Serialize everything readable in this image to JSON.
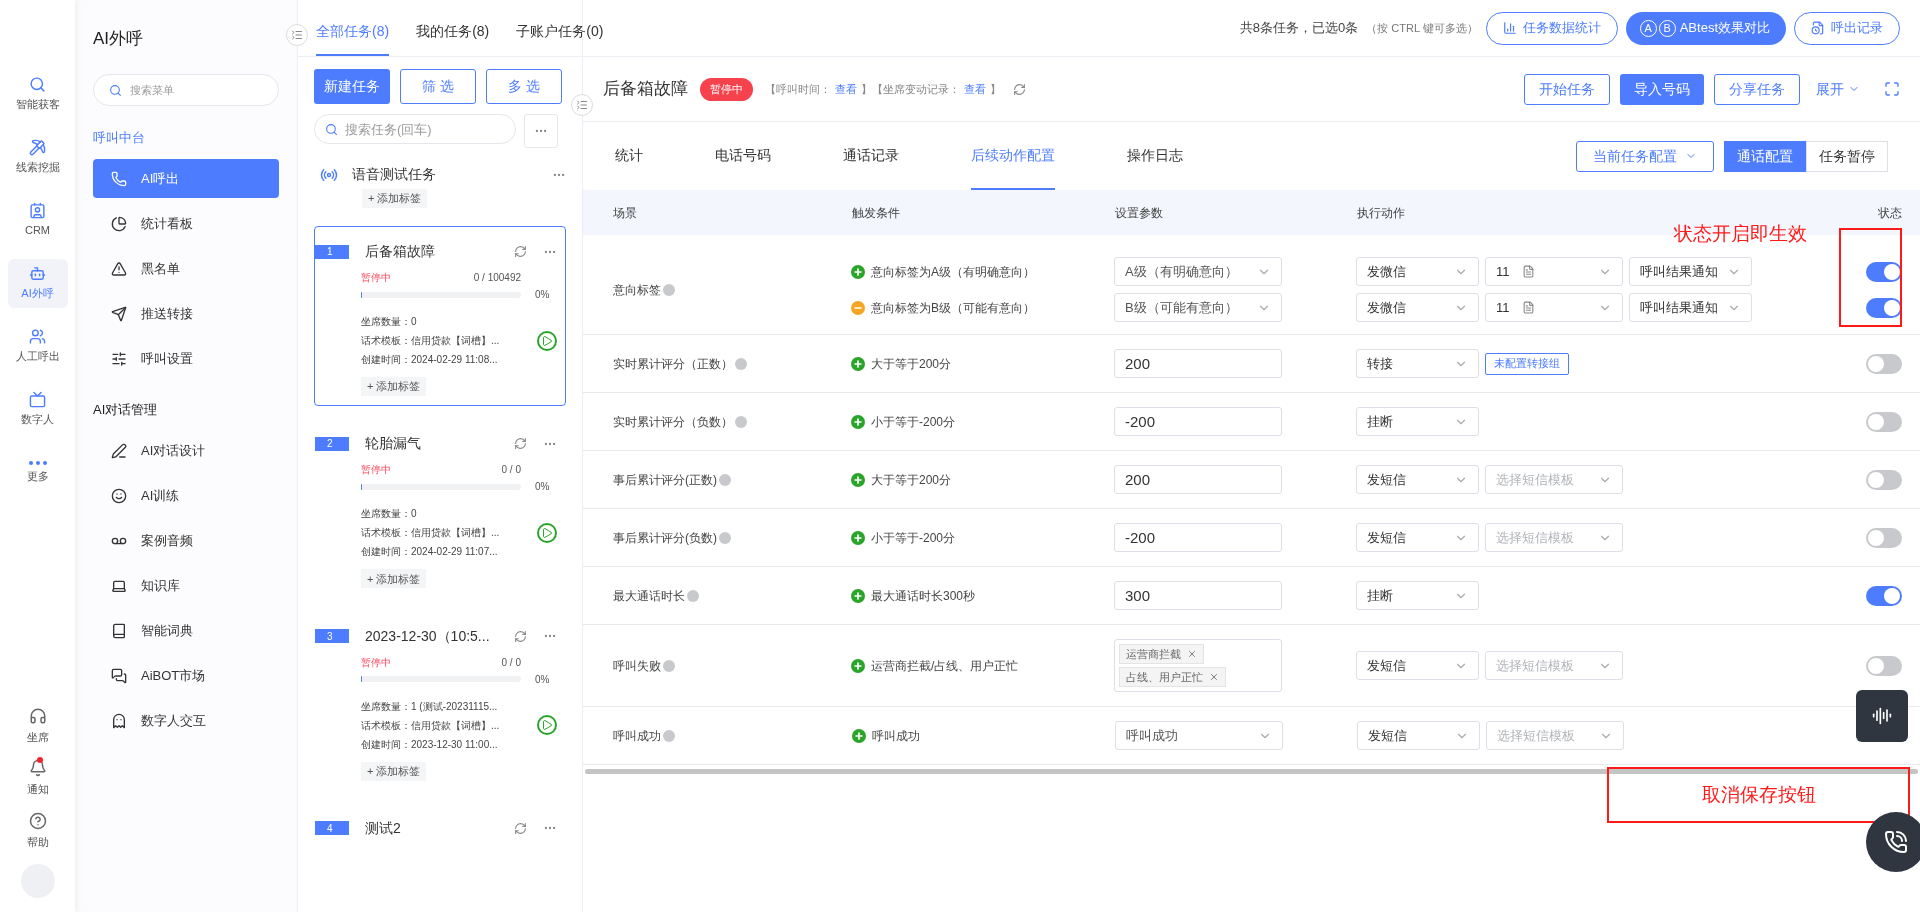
{
  "nav_rail": {
    "items": [
      {
        "label": "智能获客",
        "selected": false
      },
      {
        "label": "线索挖掘",
        "selected": false
      },
      {
        "label": "CRM",
        "selected": false
      },
      {
        "label": "AI外呼",
        "selected": true
      },
      {
        "label": "人工呼出",
        "selected": false
      },
      {
        "label": "数字人",
        "selected": false
      },
      {
        "label": "更多",
        "selected": false
      }
    ],
    "bottom_items": [
      {
        "label": "坐席",
        "badge": false
      },
      {
        "label": "通知",
        "badge": true
      },
      {
        "label": "帮助",
        "badge": false
      }
    ]
  },
  "sidebar": {
    "title": "AI外呼",
    "search": {
      "placeholder": "搜索菜单"
    },
    "groups": [
      {
        "title": "呼叫中台",
        "items": [
          {
            "label": "AI呼出",
            "selected": true
          },
          {
            "label": "统计看板",
            "selected": false
          },
          {
            "label": "黑名单",
            "selected": false
          },
          {
            "label": "推送转接",
            "selected": false
          },
          {
            "label": "呼叫设置",
            "selected": false
          }
        ]
      },
      {
        "title": "AI对话管理",
        "items": [
          {
            "label": "AI对话设计",
            "selected": false
          },
          {
            "label": "AI训练",
            "selected": false
          },
          {
            "label": "案例音频",
            "selected": false
          },
          {
            "label": "知识库",
            "selected": false
          },
          {
            "label": "智能词典",
            "selected": false
          },
          {
            "label": "AiBOT市场",
            "selected": false
          },
          {
            "label": "数字人交互",
            "selected": false
          }
        ]
      }
    ]
  },
  "task_panel": {
    "tabs": [
      {
        "label": "全部任务(8)",
        "selected": true
      },
      {
        "label": "我的任务(8)",
        "selected": false
      },
      {
        "label": "子账户任务(0)",
        "selected": false
      }
    ],
    "buttons": [
      {
        "label": "新建任务",
        "kind": "primary"
      },
      {
        "label": "筛 选",
        "kind": "outline"
      },
      {
        "label": "多 选",
        "kind": "outline"
      }
    ],
    "search": {
      "placeholder": "搜索任务(回车)"
    },
    "group": {
      "title": "语音测试任务",
      "tag_button": "+ 添加标签"
    },
    "tasks": [
      {
        "number": "1",
        "title": "后备箱故障",
        "status": "暂停中",
        "count": "0 / 100492",
        "level": 0,
        "percent": "0%",
        "seats": "坐席数量：0",
        "template": "话术模板：信用贷款【词槽】...",
        "created": "创建时间：2024-02-29 11:08...",
        "tag_button": "+ 添加标签",
        "selected": true
      },
      {
        "number": "2",
        "title": "轮胎漏气",
        "status": "暂停中",
        "count": "0 / 0",
        "level": 0,
        "percent": "0%",
        "seats": "坐席数量：0",
        "template": "话术模板：信用贷款【词槽】...",
        "created": "创建时间：2024-02-29 11:07...",
        "tag_button": "+ 添加标签",
        "selected": false
      },
      {
        "number": "3",
        "title": "2023-12-30（10:5...",
        "status": "暂停中",
        "count": "0 / 0",
        "level": 0,
        "percent": "0%",
        "seats": "坐席数量：1 (测试-20231115...",
        "template": "话术模板：信用贷款【词槽】...",
        "created": "创建时间：2023-12-30 11:00...",
        "tag_button": "+ 添加标签",
        "selected": false
      },
      {
        "number": "4",
        "title": "测试2",
        "selected": false
      }
    ]
  },
  "top_bar": {
    "summary": "共8条任务，已选0条",
    "hint": "（按 CTRL 键可多选）",
    "buttons": [
      {
        "label": "任务数据统计",
        "kind": "outline"
      },
      {
        "label": "ABtest效果对比",
        "kind": "primary",
        "badges": [
          "A",
          "B"
        ]
      },
      {
        "label": "呼出记录",
        "kind": "outline"
      }
    ]
  },
  "detail": {
    "title": "后备箱故障",
    "status": "暂停中",
    "meta": [
      {
        "text": "【呼叫时间：",
        "kind": "text"
      },
      {
        "text": "查看",
        "kind": "link"
      },
      {
        "text": "】【坐席变动记录：",
        "kind": "text"
      },
      {
        "text": "查看",
        "kind": "link"
      },
      {
        "text": "】",
        "kind": "text"
      }
    ],
    "buttons": [
      {
        "label": "开始任务",
        "kind": "outline"
      },
      {
        "label": "导入号码",
        "kind": "primary"
      },
      {
        "label": "分享任务",
        "kind": "outline"
      }
    ],
    "expand": "展开",
    "tabs": [
      {
        "label": "统计",
        "selected": false
      },
      {
        "label": "电话号码",
        "selected": false
      },
      {
        "label": "通话记录",
        "selected": false
      },
      {
        "label": "后续动作配置",
        "selected": true
      },
      {
        "label": "操作日志",
        "selected": false
      }
    ],
    "config_dropdown": "当前任务配置",
    "segments": [
      {
        "label": "通话配置",
        "selected": true
      },
      {
        "label": "任务暂停",
        "selected": false
      }
    ]
  },
  "table": {
    "columns": [
      "场景",
      "触发条件",
      "设置参数",
      "执行动作",
      "状态"
    ],
    "rows": [
      {
        "scene": "意向标签",
        "lines": [
          {
            "positive": true,
            "condition": "意向标签为A级（有明确意向）",
            "param": {
              "kind": "select",
              "value": "A级（有明确意向）"
            },
            "actions": [
              {
                "kind": "select",
                "value": "发微信"
              },
              {
                "kind": "doc_select",
                "value": "11"
              },
              {
                "kind": "select",
                "value": "呼叫结果通知"
              }
            ],
            "on": true
          },
          {
            "positive": false,
            "condition": "意向标签为B级（可能有意向）",
            "param": {
              "kind": "select",
              "value": "B级（可能有意向）"
            },
            "actions": [
              {
                "kind": "select",
                "value": "发微信"
              },
              {
                "kind": "doc_select",
                "value": "11"
              },
              {
                "kind": "select",
                "value": "呼叫结果通知"
              }
            ],
            "on": true
          }
        ]
      },
      {
        "scene": "实时累计评分（正数）",
        "lines": [
          {
            "positive": true,
            "condition": "大于等于200分",
            "param": {
              "kind": "input",
              "value": "200"
            },
            "actions": [
              {
                "kind": "select",
                "value": "转接"
              },
              {
                "kind": "button",
                "value": "未配置转接组"
              }
            ],
            "on": false
          }
        ]
      },
      {
        "scene": "实时累计评分（负数）",
        "lines": [
          {
            "positive": true,
            "condition": "小于等于-200分",
            "param": {
              "kind": "input",
              "value": "-200"
            },
            "actions": [
              {
                "kind": "select",
                "value": "挂断"
              }
            ],
            "on": false
          }
        ]
      },
      {
        "scene": "事后累计评分(正数)",
        "lines": [
          {
            "positive": true,
            "condition": "大于等于200分",
            "param": {
              "kind": "input",
              "value": "200"
            },
            "actions": [
              {
                "kind": "select",
                "value": "发短信"
              },
              {
                "kind": "select",
                "placeholder": "选择短信模板"
              }
            ],
            "on": false
          }
        ]
      },
      {
        "scene": "事后累计评分(负数)",
        "lines": [
          {
            "positive": true,
            "condition": "小于等于-200分",
            "param": {
              "kind": "input",
              "value": "-200"
            },
            "actions": [
              {
                "kind": "select",
                "value": "发短信"
              },
              {
                "kind": "select",
                "placeholder": "选择短信模板"
              }
            ],
            "on": false
          }
        ]
      },
      {
        "scene": "最大通话时长",
        "lines": [
          {
            "positive": true,
            "condition": "最大通话时长300秒",
            "param": {
              "kind": "input",
              "value": "300"
            },
            "actions": [
              {
                "kind": "select",
                "value": "挂断"
              }
            ],
            "on": true
          }
        ]
      },
      {
        "scene": "呼叫失败",
        "lines": [
          {
            "positive": true,
            "condition": "运营商拦截/占线、用户正忙",
            "param": {
              "kind": "tags",
              "values": [
                "运营商拦截",
                "占线、用户正忙"
              ]
            },
            "actions": [
              {
                "kind": "select",
                "value": "发短信"
              },
              {
                "kind": "select",
                "placeholder": "选择短信模板"
              }
            ],
            "on": false
          }
        ]
      },
      {
        "scene": "呼叫成功",
        "lines": [
          {
            "positive": true,
            "condition": "呼叫成功",
            "param": {
              "kind": "select",
              "value": "呼叫成功"
            },
            "actions": [
              {
                "kind": "select",
                "value": "发短信"
              },
              {
                "kind": "select",
                "placeholder": "选择短信模板"
              }
            ]
          }
        ]
      }
    ]
  },
  "annotations": [
    {
      "text": "状态开启即生效"
    },
    {
      "text": "取消保存按钮"
    }
  ]
}
